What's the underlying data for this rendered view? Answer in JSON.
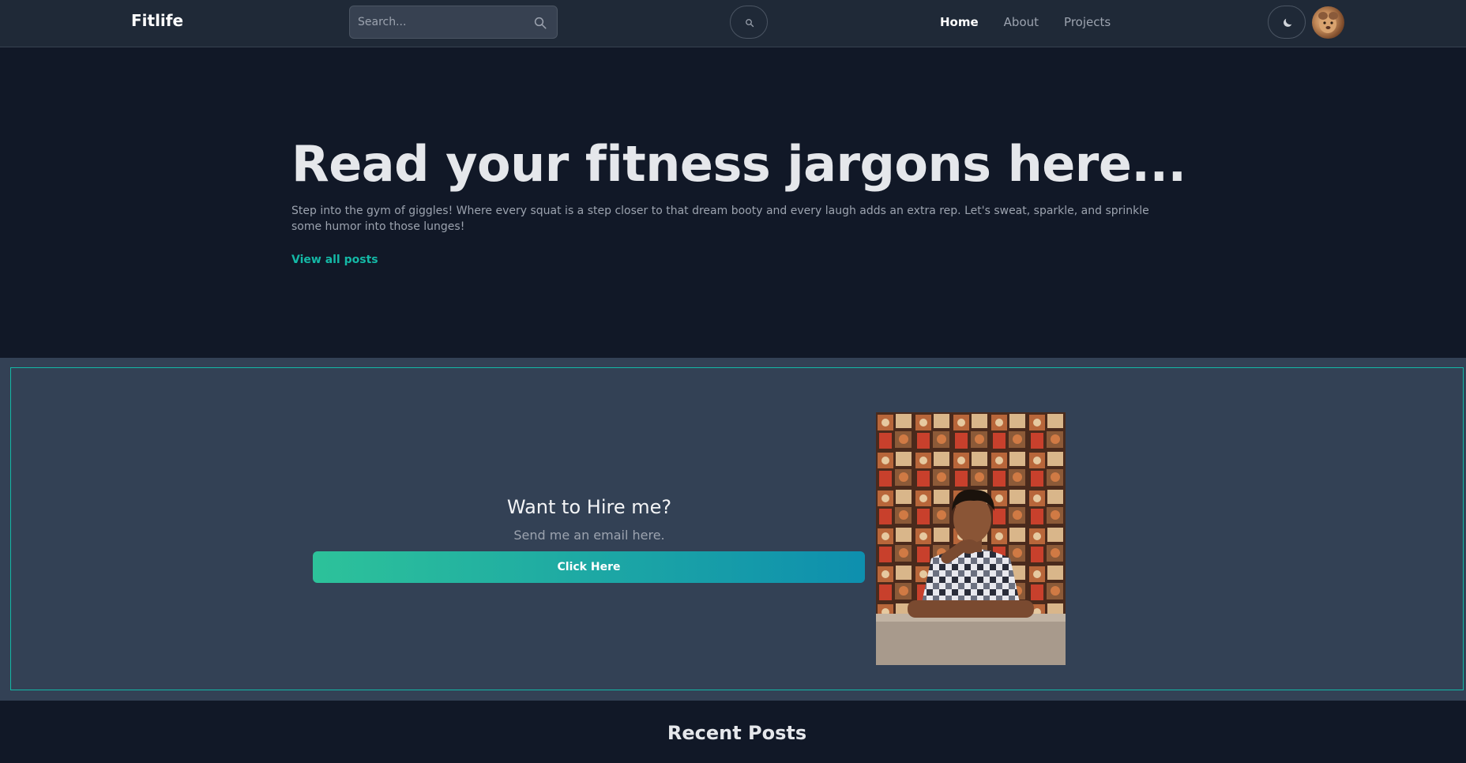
{
  "navbar": {
    "brand": "Fitlife",
    "search_placeholder": "Search...",
    "links": [
      {
        "label": "Home",
        "active": true
      },
      {
        "label": "About",
        "active": false
      },
      {
        "label": "Projects",
        "active": false
      }
    ]
  },
  "hero": {
    "title": "Read your fitness jargons here...",
    "description": "Step into the gym of giggles! Where every squat is a step closer to that dream booty and every laugh adds an extra rep. Let's sweat, sparkle, and sprinkle some humor into those lunges!",
    "link_label": "View all posts"
  },
  "hire": {
    "title": "Want to Hire me?",
    "subtitle": "Send me an email here.",
    "button_label": "Click Here"
  },
  "recent_posts": {
    "heading": "Recent Posts"
  },
  "colors": {
    "background": "#111827",
    "navbar": "#1f2937",
    "accent": "#14b8a6",
    "card": "#334155"
  }
}
